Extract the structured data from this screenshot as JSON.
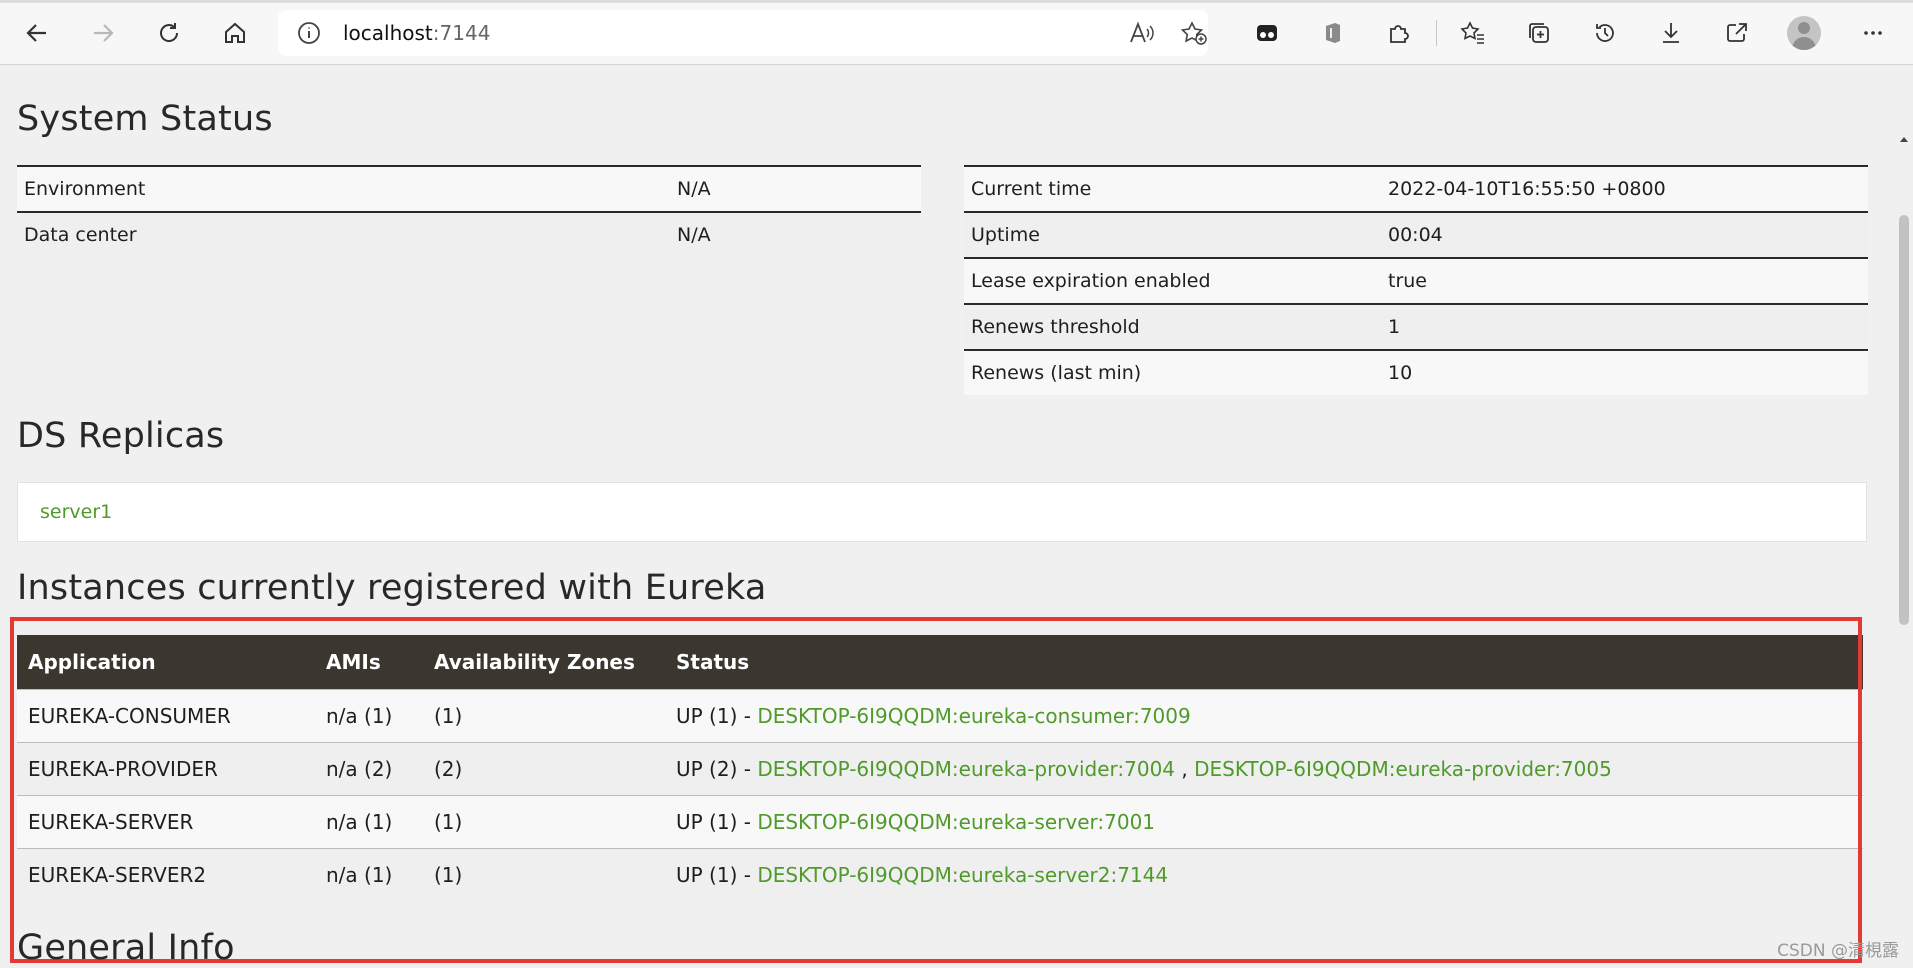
{
  "browser": {
    "url_host": "localhost",
    "url_port": ":7144"
  },
  "system_status": {
    "title": "System Status",
    "left": [
      {
        "label": "Environment",
        "value": "N/A"
      },
      {
        "label": "Data center",
        "value": "N/A"
      }
    ],
    "right": [
      {
        "label": "Current time",
        "value": "2022-04-10T16:55:50 +0800"
      },
      {
        "label": "Uptime",
        "value": "00:04"
      },
      {
        "label": "Lease expiration enabled",
        "value": "true"
      },
      {
        "label": "Renews threshold",
        "value": "1"
      },
      {
        "label": "Renews (last min)",
        "value": "10"
      }
    ]
  },
  "ds_replicas": {
    "title": "DS Replicas",
    "items": [
      "server1"
    ]
  },
  "instances": {
    "title": "Instances currently registered with Eureka",
    "headers": [
      "Application",
      "AMIs",
      "Availability Zones",
      "Status"
    ],
    "rows": [
      {
        "app": "EUREKA-CONSUMER",
        "amis_prefix": "n/a",
        "amis_count": " (1)",
        "zones": "(1)",
        "status": "UP (1) - ",
        "links": [
          "DESKTOP-6I9QQDM:eureka-consumer:7009"
        ]
      },
      {
        "app": "EUREKA-PROVIDER",
        "amis_prefix": "n/a",
        "amis_count": " (2)",
        "zones": "(2)",
        "status": "UP (2) - ",
        "links": [
          "DESKTOP-6I9QQDM:eureka-provider:7004",
          "DESKTOP-6I9QQDM:eureka-provider:7005"
        ]
      },
      {
        "app": "EUREKA-SERVER",
        "amis_prefix": "n/a",
        "amis_count": " (1)",
        "zones": "(1)",
        "status": "UP (1) - ",
        "links": [
          "DESKTOP-6I9QQDM:eureka-server:7001"
        ]
      },
      {
        "app": "EUREKA-SERVER2",
        "amis_prefix": "n/a",
        "amis_count": " (1)",
        "zones": "(1)",
        "status": "UP (1) - ",
        "links": [
          "DESKTOP-6I9QQDM:eureka-server2:7144"
        ]
      }
    ],
    "link_separator": " , "
  },
  "general_info": {
    "title": "General Info"
  },
  "watermark": "CSDN @清梘露",
  "colors": {
    "link_green": "#4f9a2b",
    "header_dark": "#3b362e",
    "highlight_red": "#e53935"
  }
}
